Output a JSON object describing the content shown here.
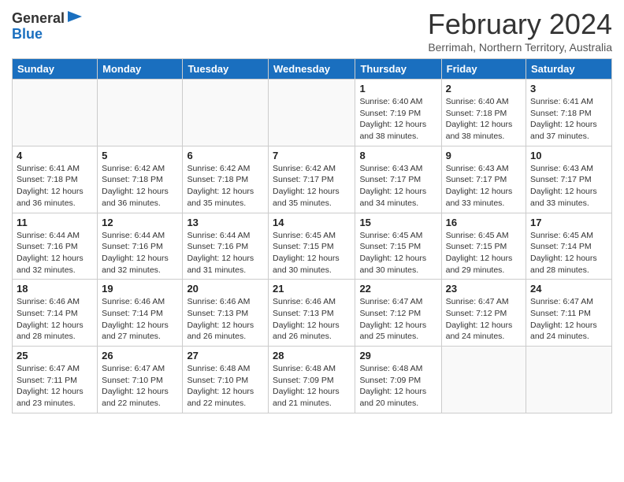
{
  "header": {
    "logo_line1": "General",
    "logo_line2": "Blue",
    "month": "February 2024",
    "location": "Berrimah, Northern Territory, Australia"
  },
  "weekdays": [
    "Sunday",
    "Monday",
    "Tuesday",
    "Wednesday",
    "Thursday",
    "Friday",
    "Saturday"
  ],
  "weeks": [
    [
      {
        "day": "",
        "info": ""
      },
      {
        "day": "",
        "info": ""
      },
      {
        "day": "",
        "info": ""
      },
      {
        "day": "",
        "info": ""
      },
      {
        "day": "1",
        "info": "Sunrise: 6:40 AM\nSunset: 7:19 PM\nDaylight: 12 hours and 38 minutes."
      },
      {
        "day": "2",
        "info": "Sunrise: 6:40 AM\nSunset: 7:18 PM\nDaylight: 12 hours and 38 minutes."
      },
      {
        "day": "3",
        "info": "Sunrise: 6:41 AM\nSunset: 7:18 PM\nDaylight: 12 hours and 37 minutes."
      }
    ],
    [
      {
        "day": "4",
        "info": "Sunrise: 6:41 AM\nSunset: 7:18 PM\nDaylight: 12 hours and 36 minutes."
      },
      {
        "day": "5",
        "info": "Sunrise: 6:42 AM\nSunset: 7:18 PM\nDaylight: 12 hours and 36 minutes."
      },
      {
        "day": "6",
        "info": "Sunrise: 6:42 AM\nSunset: 7:18 PM\nDaylight: 12 hours and 35 minutes."
      },
      {
        "day": "7",
        "info": "Sunrise: 6:42 AM\nSunset: 7:17 PM\nDaylight: 12 hours and 35 minutes."
      },
      {
        "day": "8",
        "info": "Sunrise: 6:43 AM\nSunset: 7:17 PM\nDaylight: 12 hours and 34 minutes."
      },
      {
        "day": "9",
        "info": "Sunrise: 6:43 AM\nSunset: 7:17 PM\nDaylight: 12 hours and 33 minutes."
      },
      {
        "day": "10",
        "info": "Sunrise: 6:43 AM\nSunset: 7:17 PM\nDaylight: 12 hours and 33 minutes."
      }
    ],
    [
      {
        "day": "11",
        "info": "Sunrise: 6:44 AM\nSunset: 7:16 PM\nDaylight: 12 hours and 32 minutes."
      },
      {
        "day": "12",
        "info": "Sunrise: 6:44 AM\nSunset: 7:16 PM\nDaylight: 12 hours and 32 minutes."
      },
      {
        "day": "13",
        "info": "Sunrise: 6:44 AM\nSunset: 7:16 PM\nDaylight: 12 hours and 31 minutes."
      },
      {
        "day": "14",
        "info": "Sunrise: 6:45 AM\nSunset: 7:15 PM\nDaylight: 12 hours and 30 minutes."
      },
      {
        "day": "15",
        "info": "Sunrise: 6:45 AM\nSunset: 7:15 PM\nDaylight: 12 hours and 30 minutes."
      },
      {
        "day": "16",
        "info": "Sunrise: 6:45 AM\nSunset: 7:15 PM\nDaylight: 12 hours and 29 minutes."
      },
      {
        "day": "17",
        "info": "Sunrise: 6:45 AM\nSunset: 7:14 PM\nDaylight: 12 hours and 28 minutes."
      }
    ],
    [
      {
        "day": "18",
        "info": "Sunrise: 6:46 AM\nSunset: 7:14 PM\nDaylight: 12 hours and 28 minutes."
      },
      {
        "day": "19",
        "info": "Sunrise: 6:46 AM\nSunset: 7:14 PM\nDaylight: 12 hours and 27 minutes."
      },
      {
        "day": "20",
        "info": "Sunrise: 6:46 AM\nSunset: 7:13 PM\nDaylight: 12 hours and 26 minutes."
      },
      {
        "day": "21",
        "info": "Sunrise: 6:46 AM\nSunset: 7:13 PM\nDaylight: 12 hours and 26 minutes."
      },
      {
        "day": "22",
        "info": "Sunrise: 6:47 AM\nSunset: 7:12 PM\nDaylight: 12 hours and 25 minutes."
      },
      {
        "day": "23",
        "info": "Sunrise: 6:47 AM\nSunset: 7:12 PM\nDaylight: 12 hours and 24 minutes."
      },
      {
        "day": "24",
        "info": "Sunrise: 6:47 AM\nSunset: 7:11 PM\nDaylight: 12 hours and 24 minutes."
      }
    ],
    [
      {
        "day": "25",
        "info": "Sunrise: 6:47 AM\nSunset: 7:11 PM\nDaylight: 12 hours and 23 minutes."
      },
      {
        "day": "26",
        "info": "Sunrise: 6:47 AM\nSunset: 7:10 PM\nDaylight: 12 hours and 22 minutes."
      },
      {
        "day": "27",
        "info": "Sunrise: 6:48 AM\nSunset: 7:10 PM\nDaylight: 12 hours and 22 minutes."
      },
      {
        "day": "28",
        "info": "Sunrise: 6:48 AM\nSunset: 7:09 PM\nDaylight: 12 hours and 21 minutes."
      },
      {
        "day": "29",
        "info": "Sunrise: 6:48 AM\nSunset: 7:09 PM\nDaylight: 12 hours and 20 minutes."
      },
      {
        "day": "",
        "info": ""
      },
      {
        "day": "",
        "info": ""
      }
    ]
  ]
}
